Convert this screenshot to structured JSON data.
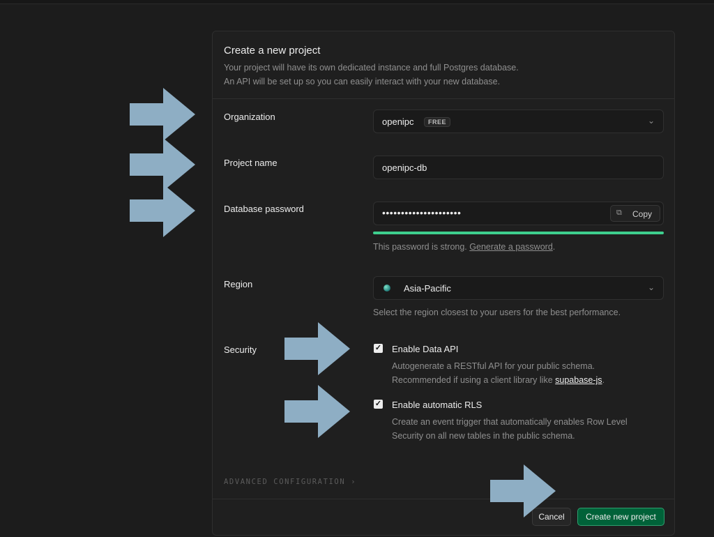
{
  "dialog": {
    "title": "Create a new project",
    "subtitle_line1": "Your project will have its own dedicated instance and full Postgres database.",
    "subtitle_line2": "An API will be set up so you can easily interact with your new database."
  },
  "organization": {
    "label": "Organization",
    "value": "openipc",
    "badge": "FREE"
  },
  "project_name": {
    "label": "Project name",
    "value": "openipc-db"
  },
  "database_password": {
    "label": "Database password",
    "masked_value": "•••••••••••••••••••••",
    "copy_label": "Copy",
    "hint_prefix": "This password is strong.",
    "hint_link": "Generate a password",
    "hint_suffix": ".",
    "strength_fraction": 1.0
  },
  "region": {
    "label": "Region",
    "value": "Asia-Pacific",
    "hint": "Select the region closest to your users for the best performance."
  },
  "security": {
    "label": "Security",
    "data_api": {
      "label": "Enable Data API",
      "checked": true,
      "desc_line1": "Autogenerate a RESTful API for your public schema.",
      "desc_line2_prefix": "Recommended if using a client library like",
      "desc_line2_link": "supabase-js",
      "desc_line2_suffix": "."
    },
    "rls": {
      "label": "Enable automatic RLS",
      "checked": true,
      "desc_line1": "Create an event trigger that automatically enables Row Level",
      "desc_line2": "Security on all new tables in the public schema."
    }
  },
  "advanced": {
    "label": "ADVANCED CONFIGURATION",
    "chevron": "›"
  },
  "footer": {
    "cancel_label": "Cancel",
    "create_label": "Create new project"
  },
  "icons": {
    "chevron_down": "⌄",
    "copy": "⧉",
    "check": "✓"
  },
  "colors": {
    "accent_green": "#3ecf8e",
    "primary_button": "#006239",
    "annotation_arrow": "#8eaec4"
  }
}
